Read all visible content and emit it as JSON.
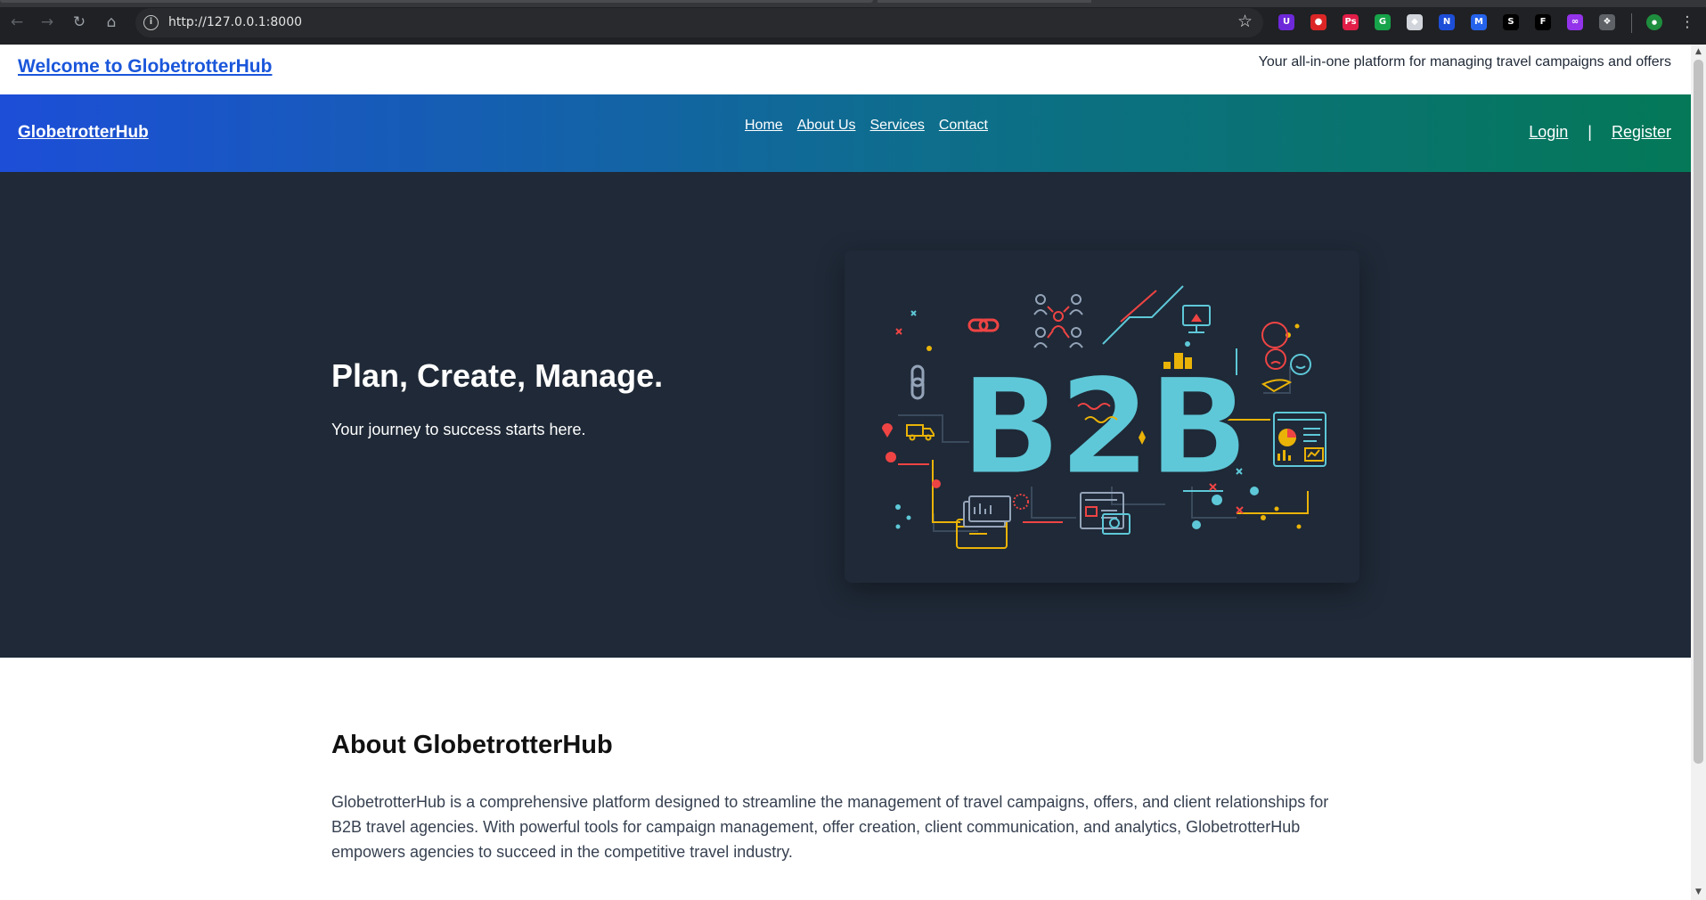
{
  "browser": {
    "url": "http://127.0.0.1:8000",
    "back_icon": "←",
    "forward_icon": "→",
    "reload_icon": "↻",
    "home_icon": "⌂",
    "info_icon": "i",
    "star_icon": "☆",
    "menu_icon": "⋮",
    "extensions": [
      {
        "name": "ext-1",
        "glyph": "U",
        "color": "#6d28d9"
      },
      {
        "name": "ext-2",
        "glyph": "●",
        "color": "#dc2626"
      },
      {
        "name": "ext-3",
        "glyph": "Ps",
        "color": "#e11d48"
      },
      {
        "name": "ext-4",
        "glyph": "G",
        "color": "#16a34a"
      },
      {
        "name": "ext-5",
        "glyph": "◆",
        "color": "#d1d5db"
      },
      {
        "name": "ext-6",
        "glyph": "N",
        "color": "#1d4ed8"
      },
      {
        "name": "ext-7",
        "glyph": "M",
        "color": "#2563eb"
      },
      {
        "name": "ext-8",
        "glyph": "S",
        "color": "#000000"
      },
      {
        "name": "ext-9",
        "glyph": "F",
        "color": "#000000"
      },
      {
        "name": "ext-10",
        "glyph": "∞",
        "color": "#9333ea"
      },
      {
        "name": "ext-11",
        "glyph": "❖",
        "color": "#5f6368"
      }
    ]
  },
  "topbar": {
    "welcome": "Welcome to GlobetrotterHub",
    "tagline": "Your all-in-one platform for managing travel campaigns and offers"
  },
  "navbar": {
    "brand": "GlobetrotterHub",
    "links": [
      "Home",
      "About Us",
      "Services",
      "Contact"
    ],
    "login": "Login",
    "separator": "|",
    "register": "Register",
    "gradient": [
      "#1d4ed8",
      "#0e6e8c",
      "#047857"
    ]
  },
  "hero": {
    "title": "Plan, Create, Manage.",
    "subtitle": "Your journey to success starts here.",
    "image_text": "B2B",
    "background": "#1f2937"
  },
  "about": {
    "title": "About GlobetrotterHub",
    "text": "GlobetrotterHub is a comprehensive platform designed to streamline the management of travel campaigns, offers, and client relationships for B2B travel agencies. With powerful tools for campaign management, offer creation, client communication, and analytics, GlobetrotterHub empowers agencies to succeed in the competitive travel industry."
  }
}
